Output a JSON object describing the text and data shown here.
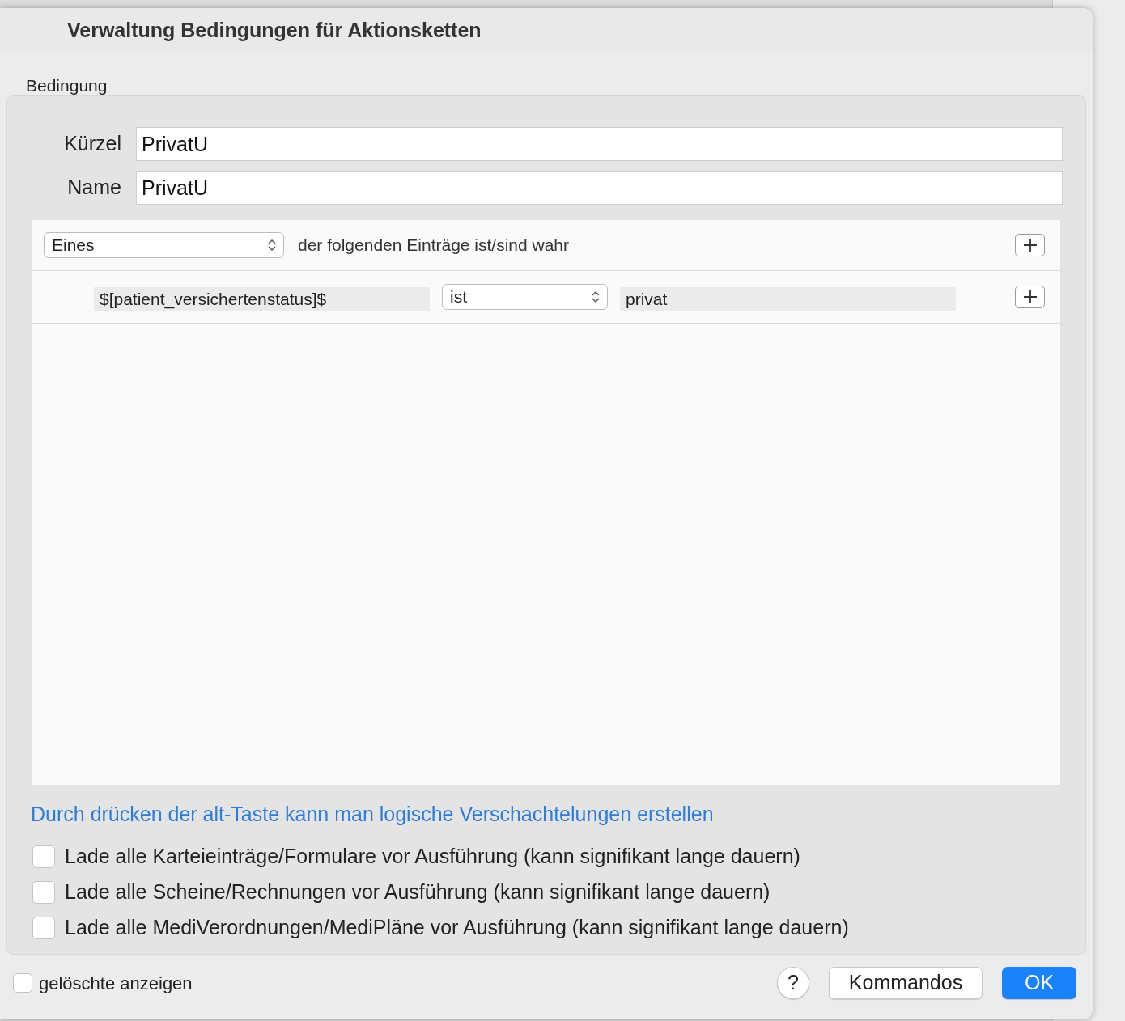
{
  "window": {
    "title": "Verwaltung Bedingungen für Aktionsketten"
  },
  "group": {
    "label": "Bedingung"
  },
  "fields": [
    {
      "label": "Kürzel",
      "value": "PrivatU"
    },
    {
      "label": "Name",
      "value": "PrivatU"
    }
  ],
  "rule_header": {
    "quantifier": "Eines",
    "text": "der folgenden Einträge ist/sind wahr"
  },
  "conditions": [
    {
      "variable": "$[patient_versichertenstatus]$",
      "operator": "ist",
      "value": "privat"
    }
  ],
  "hint": "Durch drücken der alt-Taste kann man logische Verschachtelungen erstellen",
  "options": [
    {
      "label": "Lade alle Karteieinträge/Formulare vor Ausführung (kann signifikant lange dauern)",
      "checked": false
    },
    {
      "label": "Lade alle Scheine/Rechnungen vor Ausführung (kann signifikant lange dauern)",
      "checked": false
    },
    {
      "label": "Lade alle MediVerordnungen/MediPläne vor Ausführung (kann signifikant lange dauern)",
      "checked": false
    }
  ],
  "footer": {
    "show_deleted": {
      "label": "gelöschte anzeigen",
      "checked": false
    },
    "buttons": [
      {
        "kind": "help",
        "label": "?"
      },
      {
        "kind": "default",
        "label": "Kommandos"
      },
      {
        "kind": "primary",
        "label": "OK"
      }
    ]
  }
}
